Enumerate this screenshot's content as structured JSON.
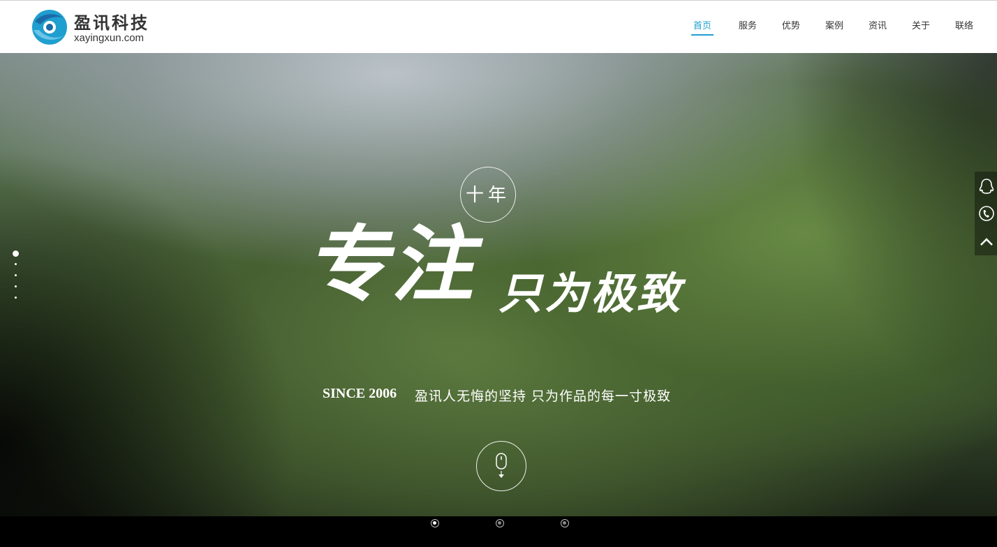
{
  "brand": {
    "name_cn": "盈讯科技",
    "domain": "xayingxun.com",
    "colors": {
      "blue": "#1f9fcf",
      "dark_blue": "#1b6aa8"
    }
  },
  "nav": {
    "items": [
      {
        "label": "首页",
        "active": true
      },
      {
        "label": "服务"
      },
      {
        "label": "优势"
      },
      {
        "label": "案例"
      },
      {
        "label": "资讯"
      },
      {
        "label": "关于"
      },
      {
        "label": "联络"
      }
    ]
  },
  "hero": {
    "ring_label": "十年",
    "headline_big": "专注",
    "headline_small": "只为极致",
    "since": "SINCE 2006",
    "tagline": "盈讯人无悔的坚持  只为作品的每一寸极致",
    "scroll_icon": "mouse-scroll-icon"
  },
  "side_pager": {
    "count": 5,
    "active_index": 0
  },
  "float_bar": {
    "icons": [
      "qq-icon",
      "phone-icon",
      "back-to-top-icon"
    ]
  },
  "bottom_pager": {
    "count": 3,
    "active_index": 0
  }
}
